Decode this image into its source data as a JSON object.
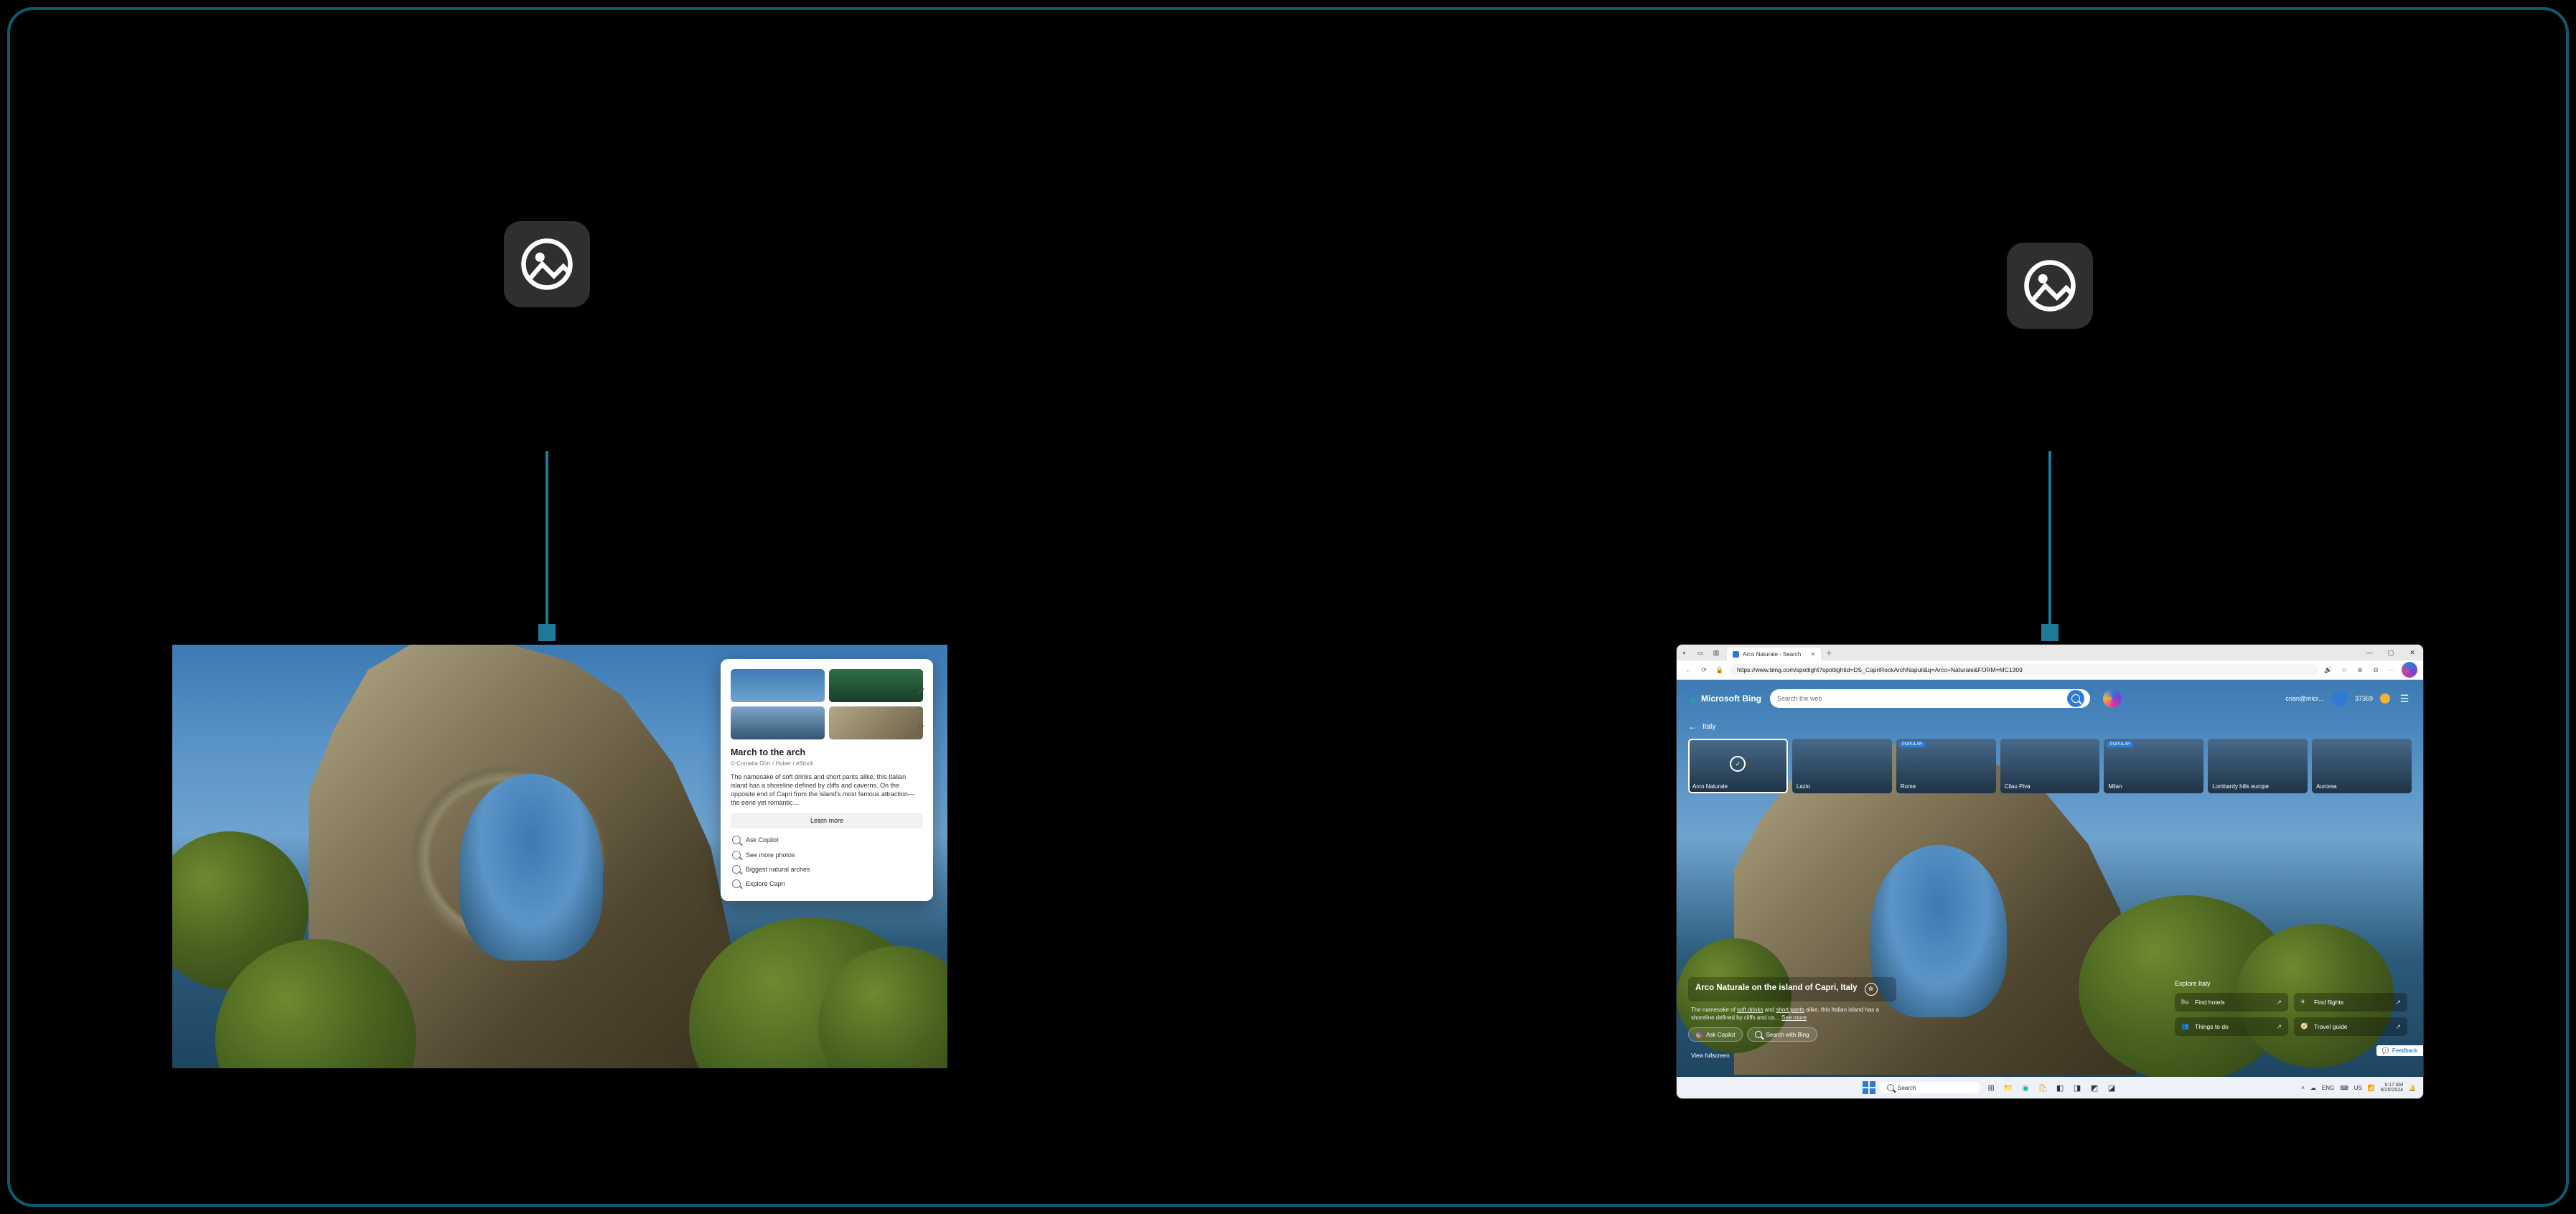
{
  "left": {
    "card": {
      "title": "March to the arch",
      "credit": "© Cornelia Dörr / Huber / eStock",
      "description": "The namesake of soft drinks and short pants alike, this Italian island has a shoreline defined by cliffs and caverns. On the opposite end of Capri from the island's most famous attraction—the eerie yet romantic…",
      "learn_more": "Learn more",
      "actions": {
        "ask_copilot": "Ask Copilot",
        "more_photos": "See more photos",
        "biggest_arches": "Biggest natural arches",
        "explore_capri": "Explore Capri"
      }
    }
  },
  "right": {
    "tab_title": "Arco Naturale - Search",
    "url": "https://www.bing.com/spotlight?spotlightid=DS_CapriRockArchNapuli&q=Arco+Naturale&FORM=MC1309",
    "bing_logo": "Microsoft Bing",
    "search_placeholder": "Search the web",
    "account": {
      "name": "crian@micr…",
      "points": "37369"
    },
    "breadcrumb": "Italy",
    "tiles": [
      {
        "label": "Arco Naturale",
        "selected": true
      },
      {
        "label": "Lazio"
      },
      {
        "label": "Rome",
        "popular": true
      },
      {
        "label": "Cilau Piva"
      },
      {
        "label": "Milan",
        "popular": true
      },
      {
        "label": "Lombardy hills europe"
      },
      {
        "label": "Aurorea"
      }
    ],
    "info": {
      "title": "Arco Naturale on the island of Capri, Italy",
      "sub_pre": "The namesake of ",
      "sub_link1": "soft drinks",
      "sub_mid": " and ",
      "sub_link2": "short pants",
      "sub_post": " alike, this Italian island has a shoreline defined by cliffs and ca…",
      "see_more": "See more",
      "ask_copilot": "Ask Copilot",
      "search_bing": "Search with Bing"
    },
    "view_fullscreen": "View fullscreen",
    "explore": {
      "heading": "Explore Italy",
      "find_hotels": "Find hotels",
      "find_flights": "Find flights",
      "things_to_do": "Things to do",
      "travel_guide": "Travel guide"
    },
    "feedback": "Feedback",
    "taskbar": {
      "search": "Search",
      "tray_flags": "ENG",
      "tray_ime": "US",
      "time": "9:17 AM",
      "date": "8/20/2024"
    }
  }
}
